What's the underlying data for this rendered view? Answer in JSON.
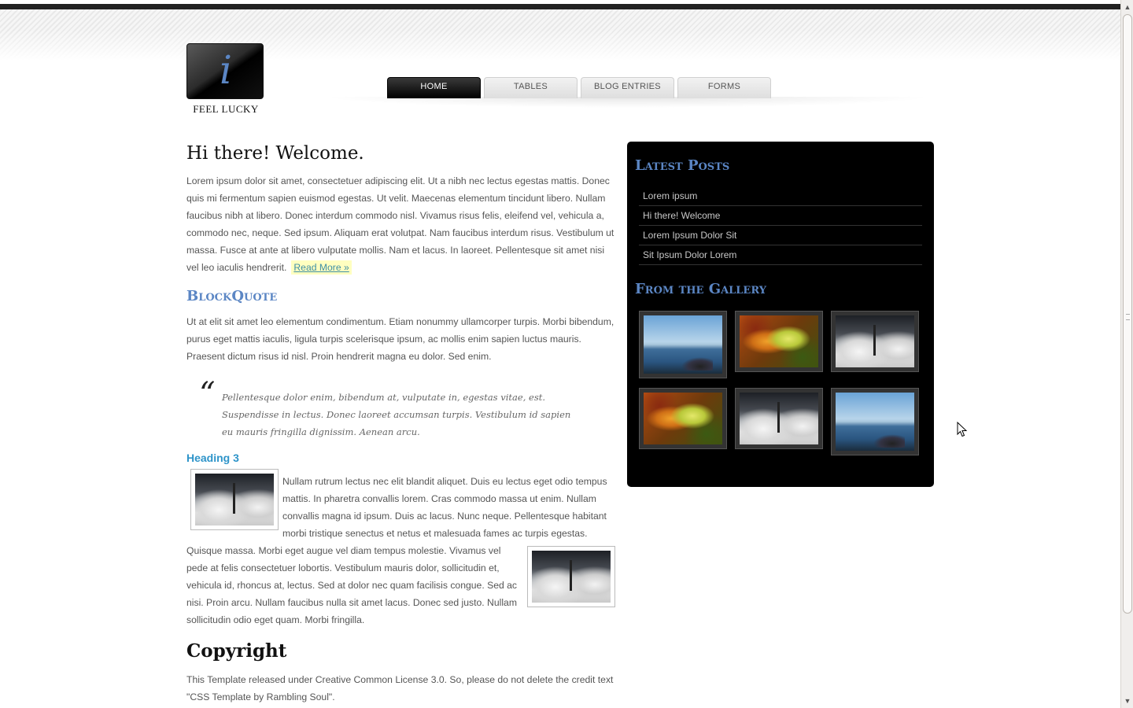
{
  "site": {
    "logo_letter": "i",
    "logo_text": "FEEL LUCKY"
  },
  "nav": {
    "tabs": [
      {
        "label": "HOME",
        "active": true
      },
      {
        "label": "TABLES",
        "active": false
      },
      {
        "label": "BLOG ENTRIES",
        "active": false
      },
      {
        "label": "FORMS",
        "active": false
      }
    ]
  },
  "main": {
    "title": "Hi there! Welcome.",
    "intro": "Lorem ipsum dolor sit amet, consectetuer adipiscing elit. Ut a nibh nec lectus egestas mattis. Donec quis mi fermentum sapien euismod egestas. Ut velit. Maecenas elementum tincidunt libero. Nullam faucibus nibh at libero. Donec interdum commodo nisl. Vivamus risus felis, eleifend vel, vehicula a, commodo nec, neque. Sed ipsum. Aliquam erat volutpat. Nam faucibus interdum risus. Vestibulum ut massa. Fusce at ante at libero vulputate mollis. Nam et lacus. In laoreet. Pellentesque sit amet nisi vel leo iaculis hendrerit.",
    "read_more": "Read More »",
    "blockquote_heading": "BlockQuote",
    "blockquote_intro": "Ut at elit sit amet leo elementum condimentum. Etiam nonummy ullamcorper turpis. Morbi bibendum, purus eget mattis iaculis, ligula turpis scelerisque ipsum, ac mollis enim sapien luctus mauris. Praesent dictum risus id nisl. Proin hendrerit magna eu dolor. Sed enim.",
    "quote_mark": "“",
    "quote": "Pellentesque dolor enim, bibendum at, vulputate in, egestas vitae, est. Suspendisse in lectus. Donec laoreet accumsan turpis. Vestibulum id sapien eu mauris fringilla dignissim. Aenean arcu.",
    "heading3": "Heading 3",
    "para3": "Nullam rutrum lectus nec elit blandit aliquet. Duis eu lectus eget odio tempus mattis. In pharetra convallis lorem. Cras commodo massa ut enim. Nullam convallis magna id ipsum. Duis ac lacus. Nunc neque. Pellentesque habitant morbi tristique senectus et netus et malesuada fames ac turpis egestas.",
    "para4": "Quisque massa. Morbi eget augue vel diam tempus molestie. Vivamus vel pede at felis consectetuer lobortis. Vestibulum mauris dolor, sollicitudin et, vehicula id, rhoncus at, lectus. Sed at dolor nec quam facilisis congue. Sed ac nisi. Proin arcu. Nullam faucibus nulla sit amet lacus. Donec sed justo. Nullam sollicitudin odio eget quam. Morbi fringilla.",
    "copyright_heading": "Copyright",
    "copyright_text": "This Template released under Creative Common License 3.0. So, please do not delete the credit text \"CSS Template by Rambling Soul\"."
  },
  "sidebar": {
    "latest_heading": "Latest Posts",
    "posts": [
      "Lorem ipsum",
      "Hi there! Welcome",
      "Lorem Ipsum Dolor Sit",
      "Sit Ipsum Dolor Lorem"
    ],
    "gallery_heading": "From the Gallery",
    "gallery": [
      "lake-photo",
      "leaf-photo",
      "snow-lamp-photo",
      "leaf-photo",
      "snow-lamp-photo",
      "lake-photo"
    ]
  },
  "colors": {
    "heading_accent": "#5b86c4",
    "heading3": "#2e94c9",
    "sidebar_bg": "#000000",
    "nav_active": "#000000"
  }
}
